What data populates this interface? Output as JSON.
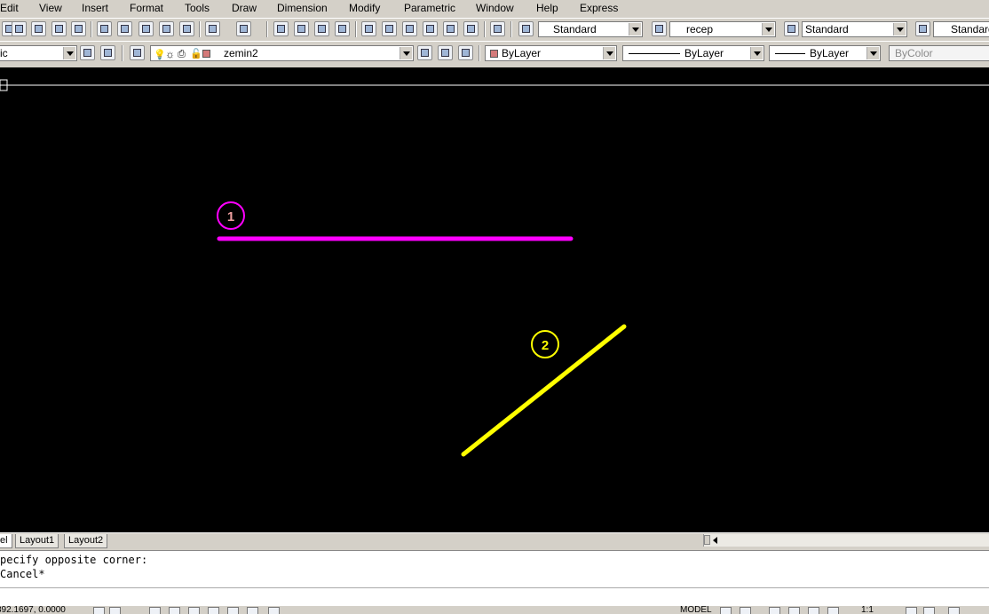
{
  "menu": [
    "Edit",
    "View",
    "Insert",
    "Format",
    "Tools",
    "Draw",
    "Dimension",
    "Modify",
    "Parametric",
    "Window",
    "Help",
    "Express"
  ],
  "toolbar1": {
    "text_style": "Standard",
    "dim_style": "recep",
    "table_style": "Standard",
    "multileader_style": "Standard"
  },
  "toolbar2": {
    "workspace": "ic",
    "layer": "zemin2",
    "color": "ByLayer",
    "linetype": "ByLayer",
    "lineweight": "ByLayer",
    "plotstyle": "ByColor"
  },
  "colors": {
    "canvas": "#000000",
    "line_1": "#ff00ff",
    "line_2": "#ffff00",
    "layer_swatch": "#d47a7a"
  },
  "drawing": {
    "label_1": "1",
    "label_2": "2"
  },
  "tabs": {
    "model": "el",
    "layout1": "Layout1",
    "layout2": "Layout2"
  },
  "command": {
    "line1": "pecify opposite corner:",
    "line2": "Cancel*"
  },
  "status": {
    "coords": "892.1697, 0.0000",
    "model": "MODEL",
    "scale": "1:1"
  }
}
